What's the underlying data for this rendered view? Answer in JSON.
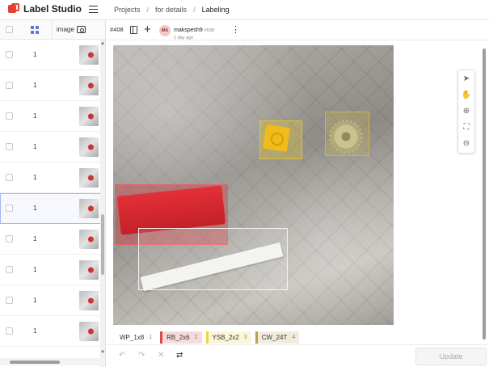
{
  "app": {
    "title": "Label Studio"
  },
  "breadcrumbs": [
    "Projects",
    "for details",
    "Labeling"
  ],
  "breadcrumb_sep": "/",
  "task_list": {
    "column_header": "image",
    "rows": [
      {
        "value": "1"
      },
      {
        "value": "1"
      },
      {
        "value": "1"
      },
      {
        "value": "1"
      },
      {
        "value": "1"
      },
      {
        "value": "1",
        "selected": true
      },
      {
        "value": "1"
      },
      {
        "value": "1"
      },
      {
        "value": "1"
      },
      {
        "value": "1"
      }
    ]
  },
  "annotation": {
    "task_id": "#408",
    "user": {
      "initials": "MA",
      "name": "makspesh9",
      "id": "#538",
      "time": "1 day ago"
    }
  },
  "regions": [
    {
      "label": "RB_2x6",
      "color": "#e8616a"
    },
    {
      "label": "YSB_2x2",
      "color": "#e2c22e"
    },
    {
      "label": "CW_24T",
      "color": "#cbb743"
    },
    {
      "label": "WP_1x8",
      "color": "#f5f5f5"
    }
  ],
  "labels": [
    {
      "name": "WP_1x8",
      "hotkey": "1",
      "color": "#ffffff"
    },
    {
      "name": "RB_2x6",
      "hotkey": "2",
      "color": "#d94c4c"
    },
    {
      "name": "YSB_2x2",
      "hotkey": "3",
      "color": "#f2d33a"
    },
    {
      "name": "CW_24T",
      "hotkey": "4",
      "color": "#b8a050"
    }
  ],
  "tools": [
    "pointer-icon",
    "hand-icon",
    "zoom-in-icon",
    "fit-icon",
    "zoom-out-icon"
  ],
  "bottom": {
    "update_label": "Update"
  }
}
